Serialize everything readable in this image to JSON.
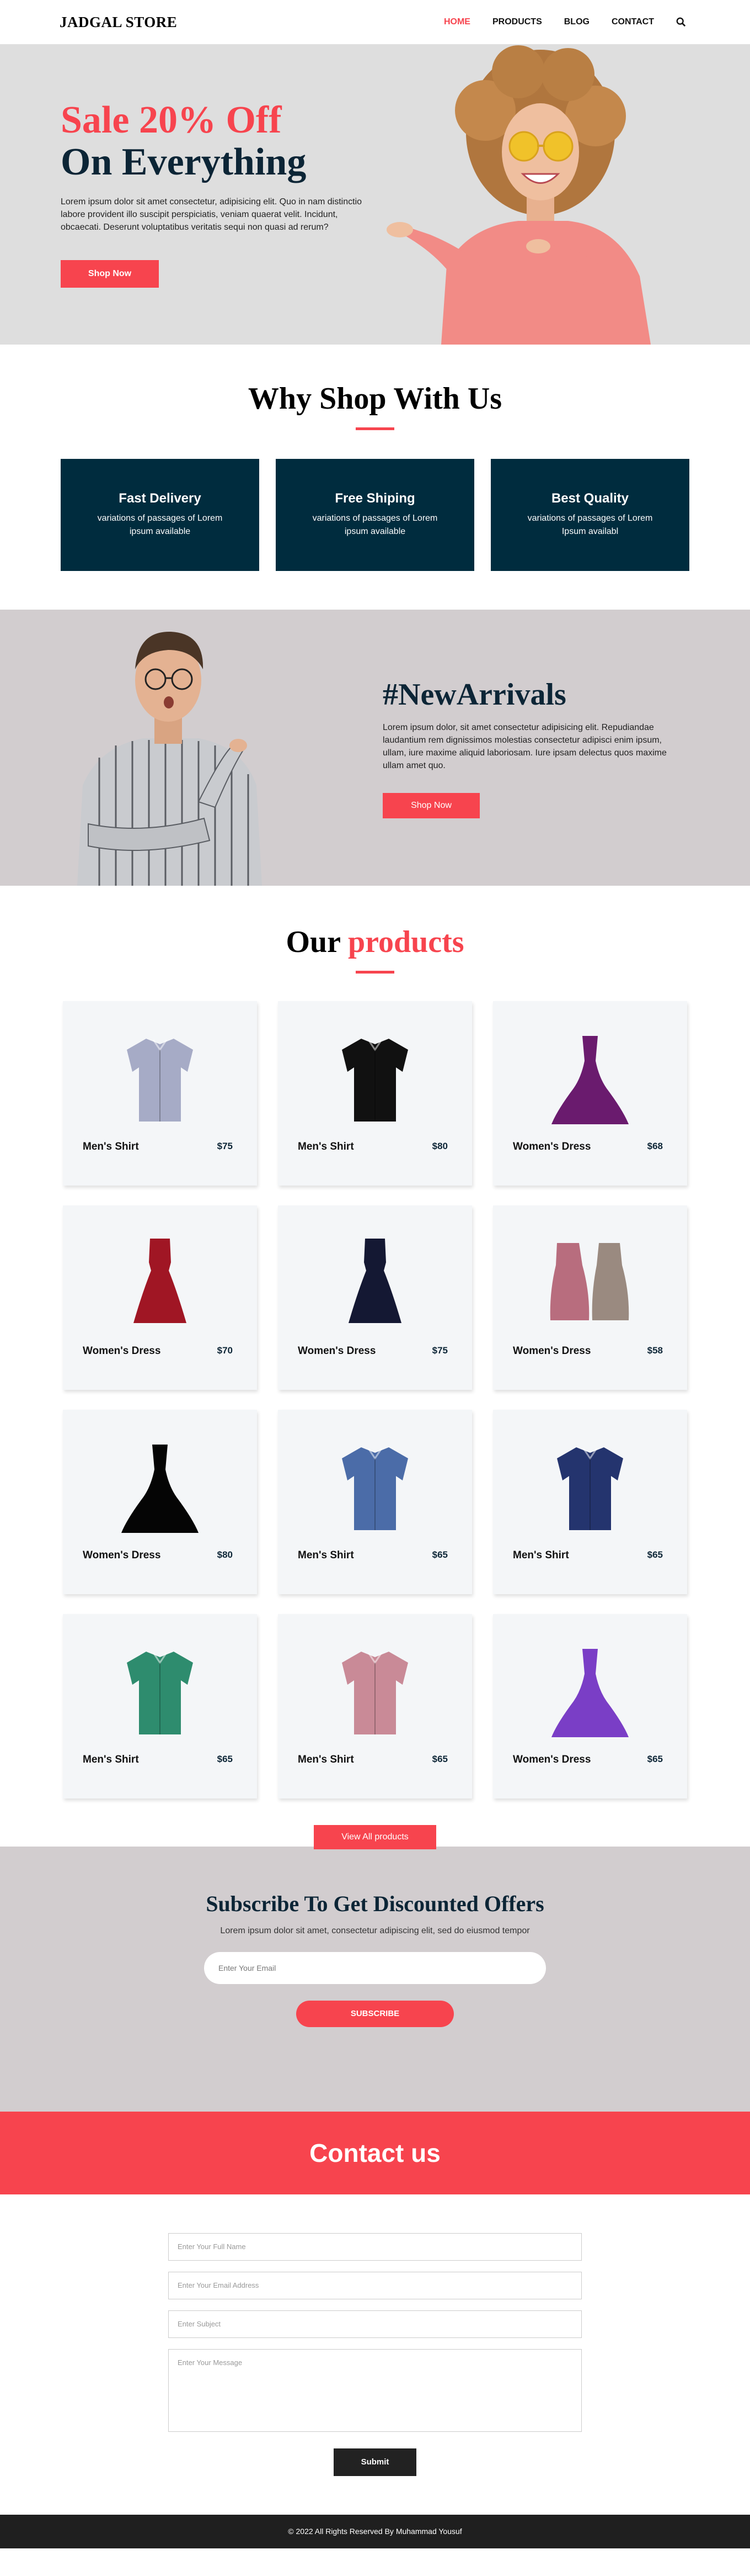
{
  "header": {
    "logo": "JADGAL STORE",
    "nav": [
      "HOME",
      "PRODUCTS",
      "BLOG",
      "CONTACT"
    ]
  },
  "hero": {
    "title_line1": "Sale 20% Off",
    "title_line2": "On Everything",
    "text": "Lorem ipsum dolor sit amet consectetur, adipisicing elit. Quo in nam distinctio labore provident illo suscipit perspiciatis, veniam quaerat velit. Incidunt, obcaecati. Deserunt voluptatibus veritatis sequi non quasi ad rerum?",
    "button": "Shop Now"
  },
  "why": {
    "title": "Why Shop With Us",
    "cards": [
      {
        "title": "Fast Delivery",
        "text": "variations of passages of Lorem ipsum available"
      },
      {
        "title": "Free Shiping",
        "text": "variations of passages of Lorem ipsum available"
      },
      {
        "title": "Best Quality",
        "text": "variations of passages of Lorem Ipsum availabl"
      }
    ]
  },
  "arrivals": {
    "title": "#NewArrivals",
    "text": "Lorem ipsum dolor, sit amet consectetur adipisicing elit. Repudiandae laudantium rem dignissimos molestias consectetur adipisci enim ipsum, ullam, iure maxime aliquid laboriosam. Iure ipsam delectus quos maxime ullam amet quo.",
    "button": "Shop Now"
  },
  "products": {
    "title_a": "Our",
    "title_b": "products",
    "items": [
      {
        "name": "Men's Shirt",
        "price": "$75",
        "kind": "shirt",
        "color": "#a6abc6"
      },
      {
        "name": "Men's Shirt",
        "price": "$80",
        "kind": "shirt",
        "color": "#111111"
      },
      {
        "name": "Women's Dress",
        "price": "$68",
        "kind": "gown",
        "color": "#6a1b6e"
      },
      {
        "name": "Women's Dress",
        "price": "$70",
        "kind": "dress",
        "color": "#a01624"
      },
      {
        "name": "Women's Dress",
        "price": "$75",
        "kind": "dress",
        "color": "#141833"
      },
      {
        "name": "Women's Dress",
        "price": "$58",
        "kind": "dress2",
        "color": "#b86d7e"
      },
      {
        "name": "Women's Dress",
        "price": "$80",
        "kind": "gown",
        "color": "#050505"
      },
      {
        "name": "Men's Shirt",
        "price": "$65",
        "kind": "shirt",
        "color": "#4b6ca8"
      },
      {
        "name": "Men's Shirt",
        "price": "$65",
        "kind": "shirt",
        "color": "#24346e"
      },
      {
        "name": "Men's Shirt",
        "price": "$65",
        "kind": "shirt",
        "color": "#2e8c6e"
      },
      {
        "name": "Men's Shirt",
        "price": "$65",
        "kind": "shirt",
        "color": "#c98a97"
      },
      {
        "name": "Women's Dress",
        "price": "$65",
        "kind": "gown",
        "color": "#7a3ec6"
      }
    ],
    "view_all": "View All products"
  },
  "subscribe": {
    "title": "Subscribe To Get Discounted Offers",
    "text": "Lorem ipsum dolor sit amet, consectetur adipiscing elit, sed do eiusmod tempor",
    "placeholder": "Enter Your Email",
    "button": "SUBSCRIBE"
  },
  "contact": {
    "title": "Contact us",
    "name_placeholder": "Enter Your Full Name",
    "email_placeholder": "Enter Your Email Address",
    "subject_placeholder": "Enter Subject",
    "message_placeholder": "Enter Your Message",
    "submit": "Submit"
  },
  "footer": {
    "text": "© 2022 All Rights Reserved By Muhammad Yousuf"
  },
  "colors": {
    "accent": "#f7444e",
    "navy": "#002c3e",
    "section_bg": "#d2cdcf"
  }
}
